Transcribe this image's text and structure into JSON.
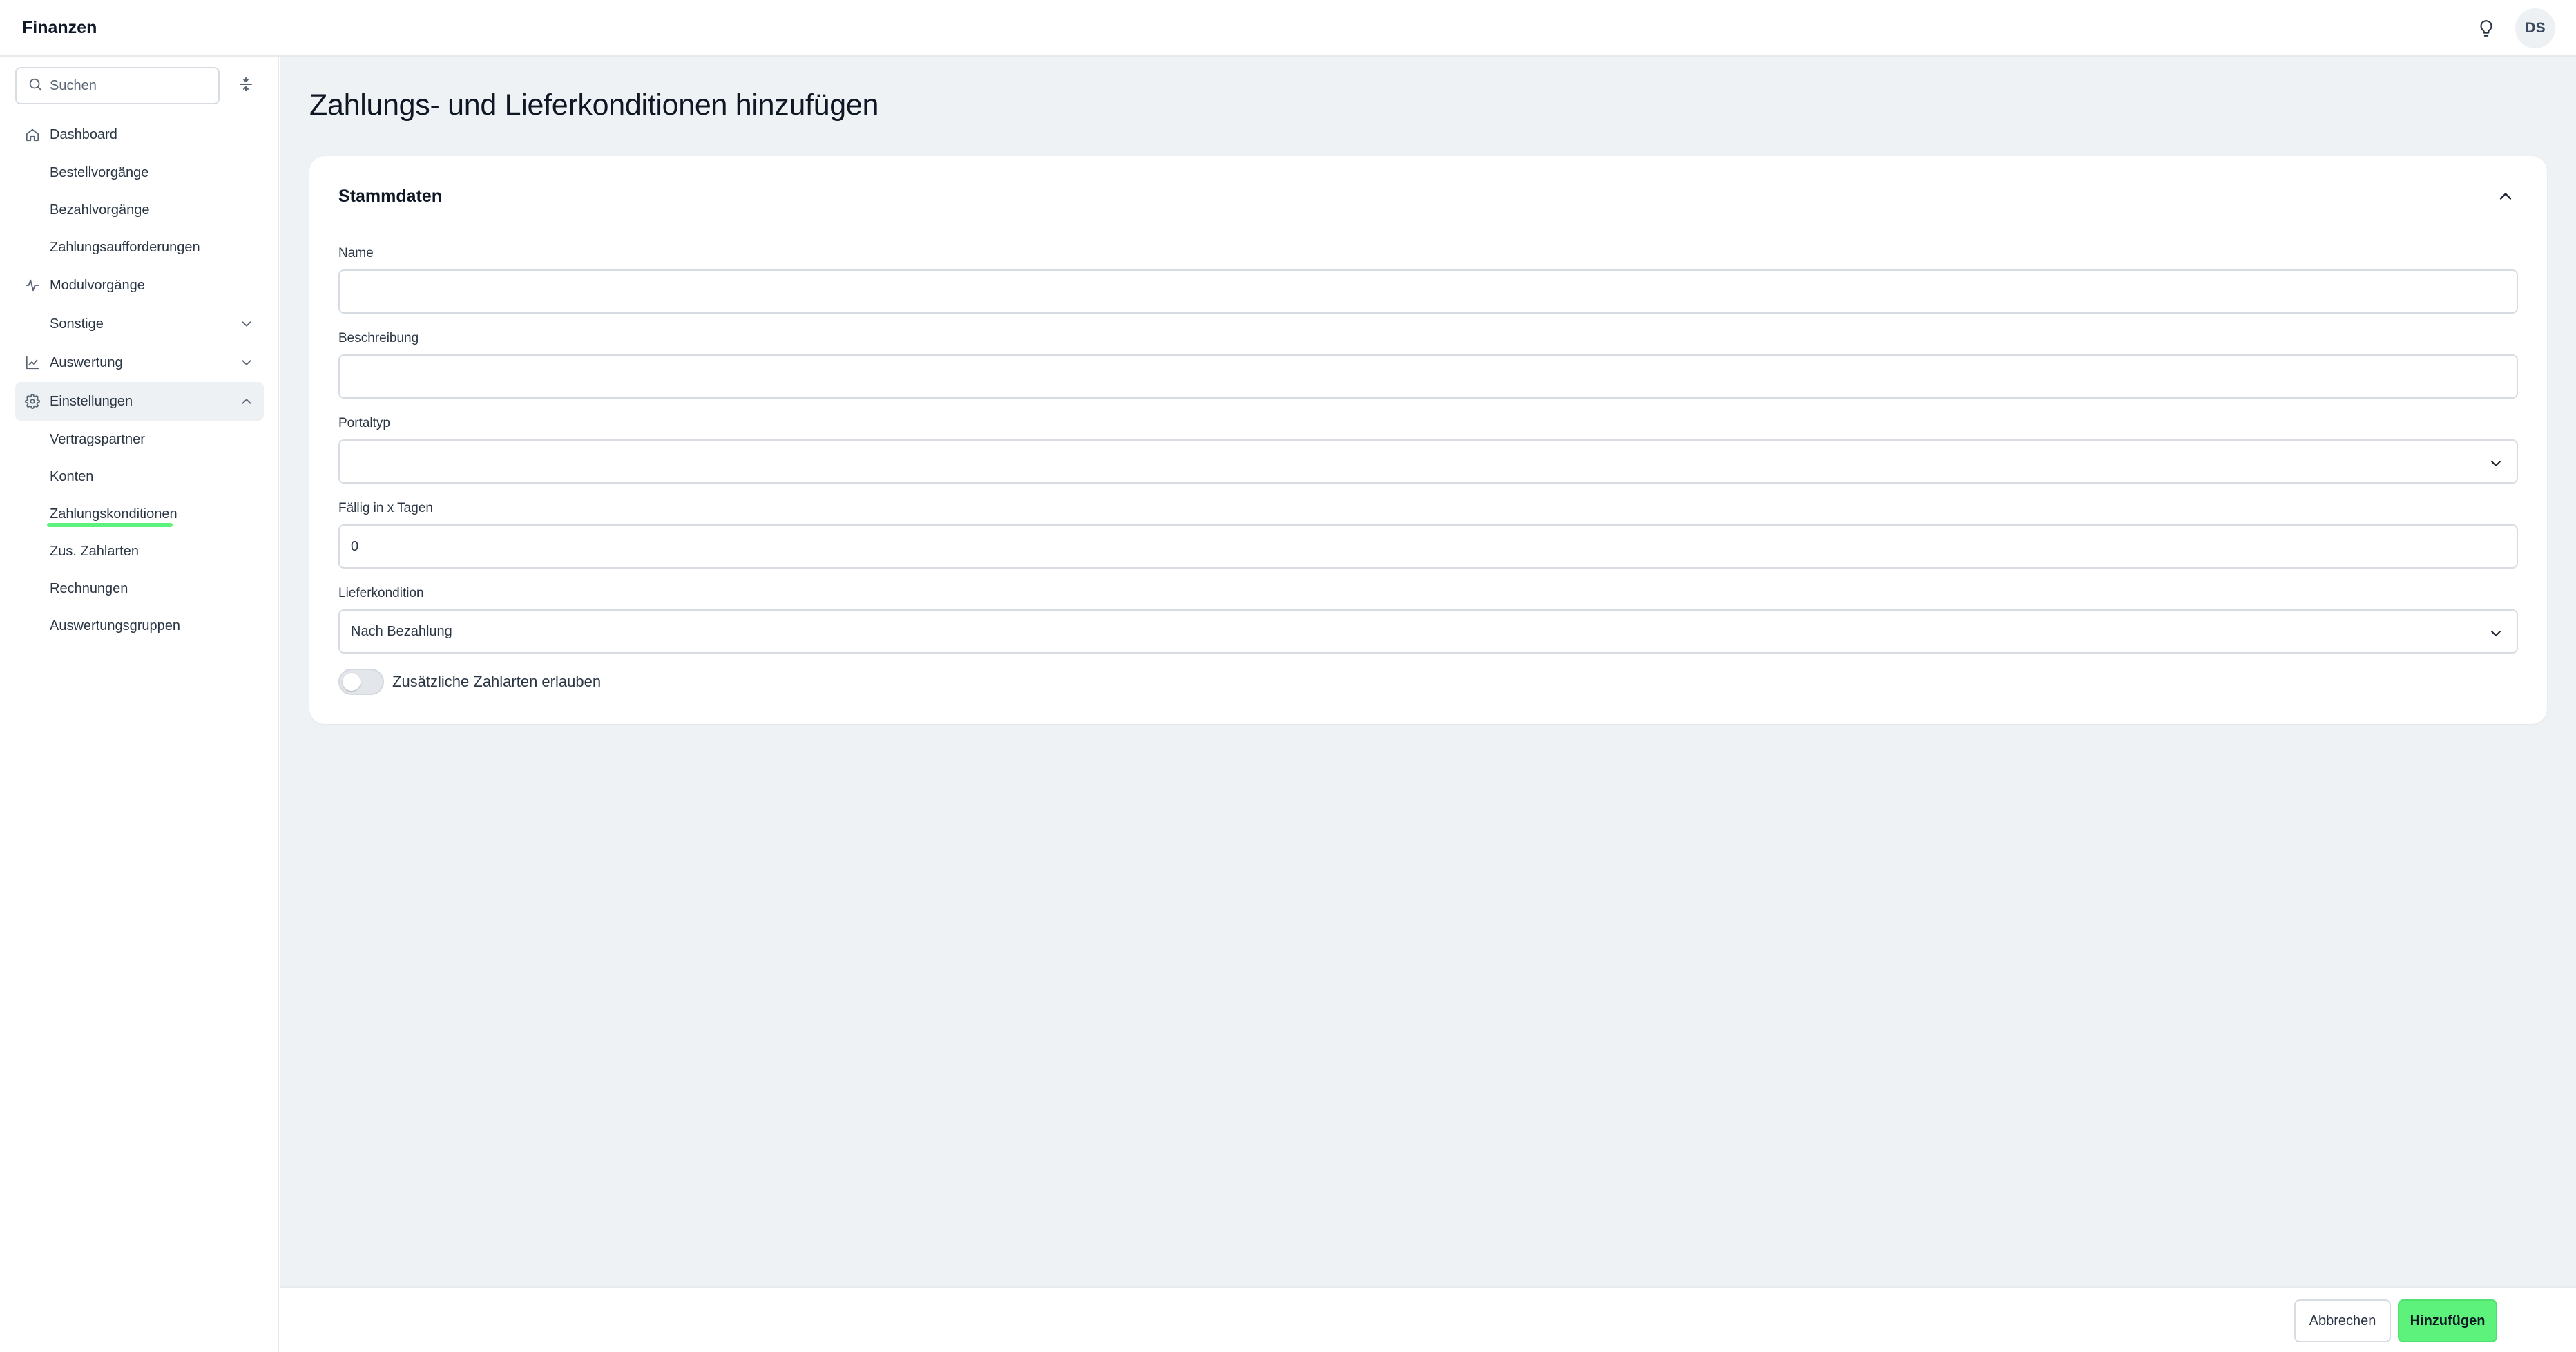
{
  "header": {
    "app_title": "Finanzen",
    "icon": "lightbulb-icon",
    "avatar_initials": "DS"
  },
  "sidebar": {
    "search_placeholder": "Suchen",
    "items": [
      {
        "label": "Dashboard",
        "icon": "home-icon"
      },
      {
        "label": "Bestellvorgänge"
      },
      {
        "label": "Bezahlvorgänge"
      },
      {
        "label": "Zahlungsaufforderungen"
      },
      {
        "label": "Modulvorgänge",
        "icon": "activity-icon"
      },
      {
        "label": "Sonstige",
        "expandable": true
      },
      {
        "label": "Auswertung",
        "icon": "chart-icon",
        "expandable": true
      },
      {
        "label": "Einstellungen",
        "icon": "gear-icon",
        "expanded": true
      }
    ],
    "settings_sub": [
      {
        "label": "Vertragspartner"
      },
      {
        "label": "Konten"
      },
      {
        "label": "Zahlungskonditionen",
        "active": true
      },
      {
        "label": "Zus. Zahlarten"
      },
      {
        "label": "Rechnungen"
      },
      {
        "label": "Auswertungsgruppen"
      }
    ],
    "accent_color": "#5cf27c"
  },
  "main": {
    "page_title": "Zahlungs- und Lieferkonditionen hinzufügen",
    "card": {
      "title": "Stammdaten",
      "fields": {
        "name": {
          "label": "Name",
          "value": ""
        },
        "description": {
          "label": "Beschreibung",
          "value": ""
        },
        "portal_type": {
          "label": "Portaltyp",
          "value": ""
        },
        "due_days": {
          "label": "Fällig in x Tagen",
          "value": "0"
        },
        "delivery": {
          "label": "Lieferkondition",
          "value": "Nach Bezahlung"
        }
      },
      "toggle": {
        "label": "Zusätzliche Zahlarten erlauben",
        "on": false
      }
    }
  },
  "footer": {
    "cancel_label": "Abbrechen",
    "add_label": "Hinzufügen"
  }
}
